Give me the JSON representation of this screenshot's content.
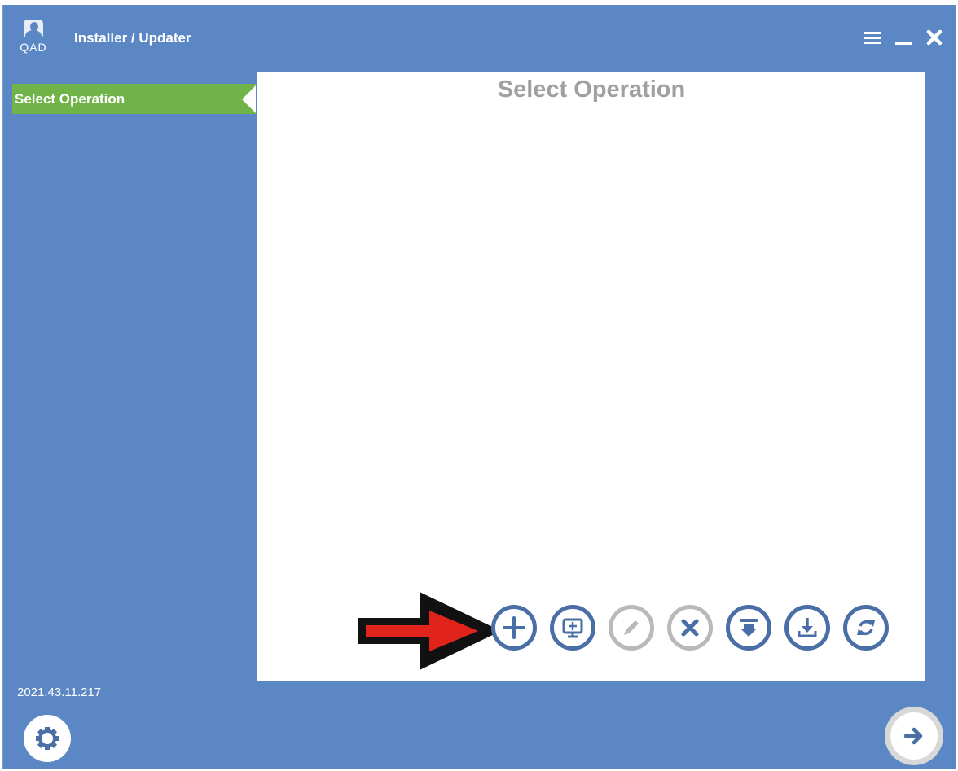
{
  "window": {
    "title": "Installer / Updater",
    "logo_text": "QAD",
    "controls": [
      {
        "name": "menu-icon"
      },
      {
        "name": "minimize-icon"
      },
      {
        "name": "close-icon"
      }
    ]
  },
  "sidebar": {
    "items": [
      {
        "label": "Select Operation",
        "active": true
      }
    ],
    "version": "2021.43.11.217"
  },
  "main": {
    "title": "Select Operation",
    "operations": [
      {
        "icon": "plus-icon",
        "enabled": true
      },
      {
        "icon": "monitor-add-icon",
        "enabled": true
      },
      {
        "icon": "pencil-icon",
        "enabled": false
      },
      {
        "icon": "x-icon",
        "enabled": false
      },
      {
        "icon": "download-arrow-icon",
        "enabled": true
      },
      {
        "icon": "download-tray-icon",
        "enabled": true
      },
      {
        "icon": "refresh-icon",
        "enabled": true
      }
    ]
  },
  "annotation": {
    "arrow_color": "#e0241b",
    "arrow_outline": "#111111"
  },
  "footer": {
    "settings_icon": "gear-icon",
    "next_icon": "arrow-right-icon"
  },
  "colors": {
    "window_bg": "#5b88c5",
    "active_item_bg": "#70b349",
    "button_blue": "#4a6fa6",
    "button_disabled": "#b9b9b9",
    "title_gray": "#a0a0a0"
  }
}
